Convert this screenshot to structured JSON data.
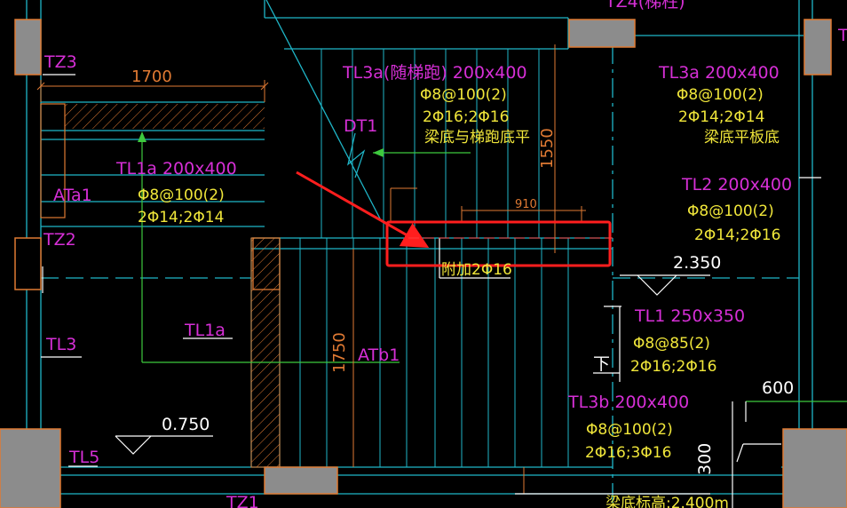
{
  "labels": {
    "tz3": "TZ3",
    "tz2": "TZ2",
    "tz1": "TZ1",
    "tz4": "TZ4(梯柱)",
    "tz_right": "T",
    "dim_1700": "1700",
    "dim_1550": "1550",
    "dim_910": "910",
    "dim_1750": "1750",
    "dim_600": "600",
    "dim_300": "300",
    "tl1a_main": "TL1a 200x400",
    "tl1a_stirrup": "Φ8@100(2)",
    "tl1a_bars": "2Φ14;2Φ14",
    "ata1": "ATa1",
    "tl1a_bottom": "TL1a",
    "tl3_left": "TL3",
    "tl5": "TL5",
    "elev_0750": "0.750",
    "atb1": "ATb1",
    "dt1": "DT1",
    "tl3a_left_title": "TL3a(随梯跑) 200x400",
    "tl3a_left_stirrup": "Φ8@100(2)",
    "tl3a_left_bars": "2Φ16;2Φ16",
    "tl3a_left_note": "梁底与梯跑底平",
    "tl3a_right_title": "TL3a 200x400",
    "tl3a_right_stirrup": "Φ8@100(2)",
    "tl3a_right_bars": "2Φ14;2Φ14",
    "tl3a_right_note": "梁底平板底",
    "tl2_title": "TL2 200x400",
    "tl2_stirrup": "Φ8@100(2)",
    "tl2_bars": "2Φ14;2Φ16",
    "elev_2350": "2.350",
    "tl1_title": "TL1 250x350",
    "tl1_stirrup": "Φ8@85(2)",
    "tl1_bars": "2Φ16;2Φ16",
    "down_mark": "下",
    "tl3b_title": "TL3b 200x400",
    "tl3b_stirrup": "Φ8@100(2)",
    "tl3b_bars": "2Φ16;3Φ16",
    "highlight_label": "附加2Φ16",
    "bottom_note": "梁底标高:2.400m"
  },
  "colors": {
    "column": "#8c8c8c",
    "column_edge": "#e07a33",
    "dim": "#e07a33",
    "cyan": "#1fb6c8",
    "green": "#3ec93e",
    "magenta": "#d62fd6",
    "yellow": "#f0e63a",
    "highlight": "#ff1e1e"
  }
}
